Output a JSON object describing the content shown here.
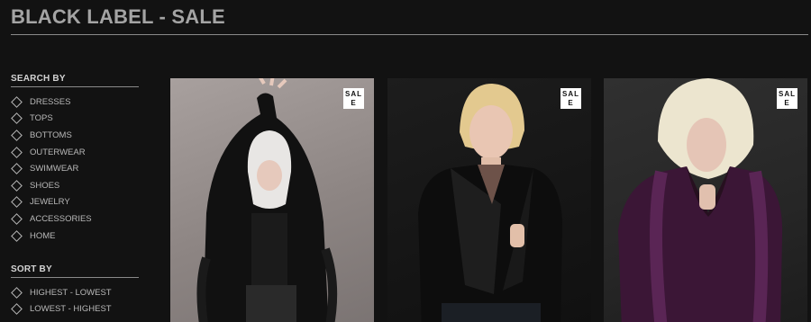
{
  "page": {
    "title": "BLACK LABEL - SALE"
  },
  "search": {
    "heading": "SEARCH BY",
    "items": [
      "DRESSES",
      "TOPS",
      "BOTTOMS",
      "OUTERWEAR",
      "SWIMWEAR",
      "SHOES",
      "JEWELRY",
      "ACCESSORIES",
      "HOME"
    ]
  },
  "sort": {
    "heading": "SORT BY",
    "items": [
      "HIGHEST - LOWEST",
      "LOWEST - HIGHEST"
    ]
  },
  "products": [
    {
      "badge": "SALE"
    },
    {
      "badge": "SALE"
    },
    {
      "badge": "SALE"
    }
  ],
  "colors": {
    "background": "#121212",
    "title": "#a4a4a4",
    "rule": "#8a8a8a",
    "badge_bg": "#ffffff"
  }
}
